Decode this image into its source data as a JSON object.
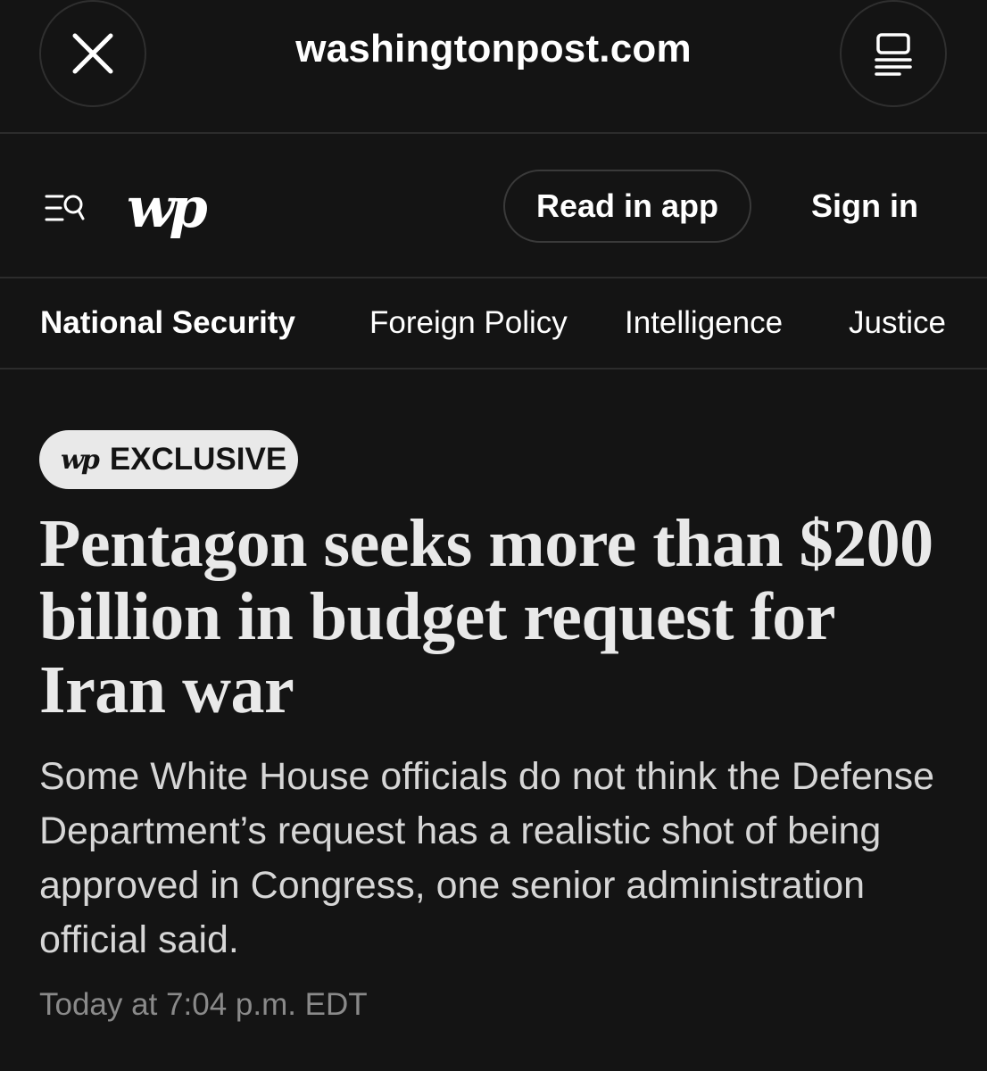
{
  "browser": {
    "url": "washingtonpost.com",
    "close_icon": "close-icon",
    "reader_icon": "reader-mode-icon"
  },
  "header": {
    "menu_icon": "menu-search-icon",
    "logo": "wp",
    "read_in_app": "Read in app",
    "sign_in": "Sign in"
  },
  "nav": {
    "items": [
      {
        "label": "National Security",
        "active": true
      },
      {
        "label": "Foreign Policy",
        "active": false
      },
      {
        "label": "Intelligence",
        "active": false
      },
      {
        "label": "Justice",
        "active": false
      }
    ]
  },
  "article": {
    "badge_logo": "wp",
    "badge_label": "EXCLUSIVE",
    "headline": "Pentagon seeks more than $200 billion in budget request for Iran war",
    "dek": "Some White House officials do not think the Defense Department’s request has a realistic shot of being approved in Congress, one senior administration official said.",
    "timestamp": "Today at 7:04 p.m. EDT"
  },
  "colors": {
    "background": "#141414",
    "text": "#ffffff",
    "headline": "#e9e9e9",
    "muted": "#8a8a8a",
    "badge_bg": "#e9e9e9"
  }
}
